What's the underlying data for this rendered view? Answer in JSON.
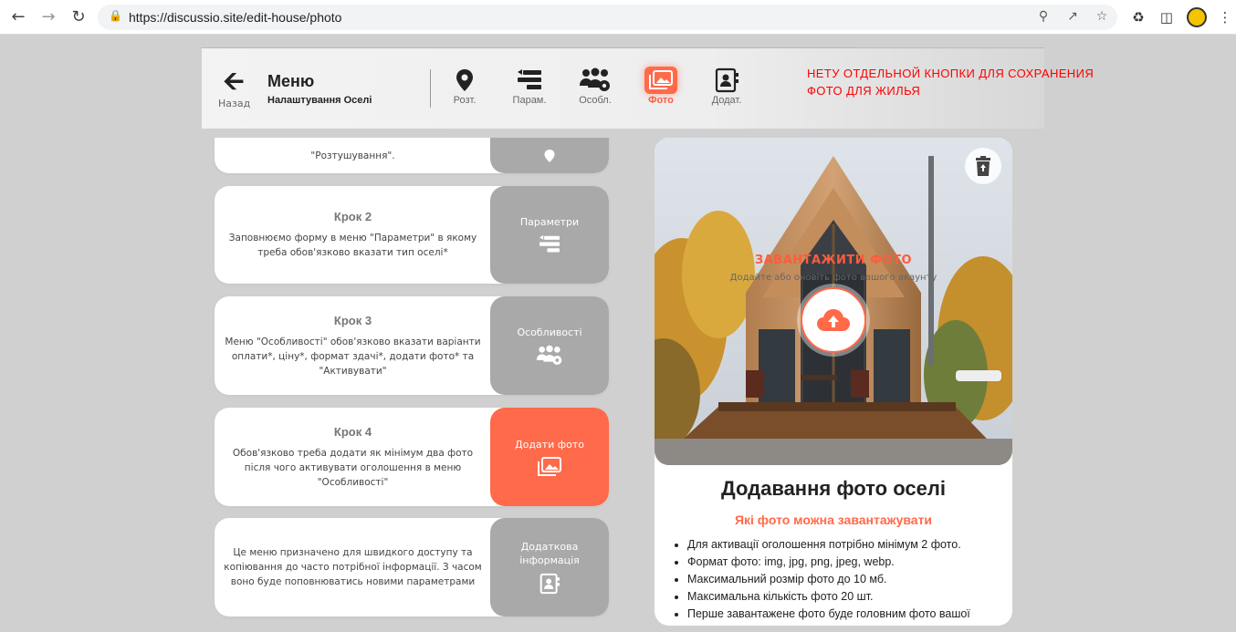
{
  "browser": {
    "url": "https://discussio.site/edit-house/photo"
  },
  "header": {
    "back_label": "Назад",
    "menu_title": "Меню",
    "menu_subtitle": "Налаштування Оселі",
    "nav": [
      {
        "label": "Розт.",
        "icon": "map-pin-icon"
      },
      {
        "label": "Парам.",
        "icon": "parameters-icon"
      },
      {
        "label": "Особл.",
        "icon": "features-icon"
      },
      {
        "label": "Фото",
        "icon": "photos-icon",
        "active": true
      },
      {
        "label": "Додат.",
        "icon": "contact-book-icon"
      }
    ],
    "note": "НЕТУ ОТДЕЛЬНОЙ КНОПКИ ДЛЯ СОХРАНЕНИЯ ФОТО ДЛЯ ЖИЛЬЯ"
  },
  "steps": [
    {
      "title": "",
      "desc": "\"Розтушування\".",
      "side_label": "",
      "icon": "map-pin-icon"
    },
    {
      "title": "Крок 2",
      "desc": "Заповнюємо форму в меню \"Параметри\" в якому треба обов'язково вказати тип оселі*",
      "side_label": "Параметри",
      "icon": "parameters-icon"
    },
    {
      "title": "Крок 3",
      "desc": "Меню \"Особливості\" обов'язково вказати варіанти оплати*, ціну*, формат здачі*, додати фото* та \"Активувати\"",
      "side_label": "Особливості",
      "icon": "features-icon"
    },
    {
      "title": "Крок 4",
      "desc": "Обов'язково треба додати як мінімум два фото після чого активувати оголошення в меню \"Особливості\"",
      "side_label": "Додати фото",
      "icon": "photos-icon"
    },
    {
      "title": "",
      "desc": "Це меню призначено для швидкого доступу та копіювання до часто потрібної інформації. З часом воно буде поповнюватись новими параметрами",
      "side_label": "Додаткова інформація",
      "icon": "contact-book-icon"
    }
  ],
  "card": {
    "upload_title": "ЗАВАНТАЖИТИ ФОТО",
    "upload_subtitle": "Додайте або оновіть фото вашого акаунту",
    "title": "Додавання фото оселі",
    "subtitle": "Які фото можна завантажувати",
    "rules": [
      "Для активації оголошення потрібно мінімум 2 фото.",
      "Формат фото: img, jpg, png, jpeg, webp.",
      "Максимальний розмір фото до 10 мб.",
      "Максимальна кількість фото 20 шт.",
      "Перше завантажене фото буде головним фото вашої"
    ]
  },
  "colors": {
    "accent": "#ff6a4a",
    "note": "#ff0000",
    "side_gray": "#a9a9a9"
  }
}
